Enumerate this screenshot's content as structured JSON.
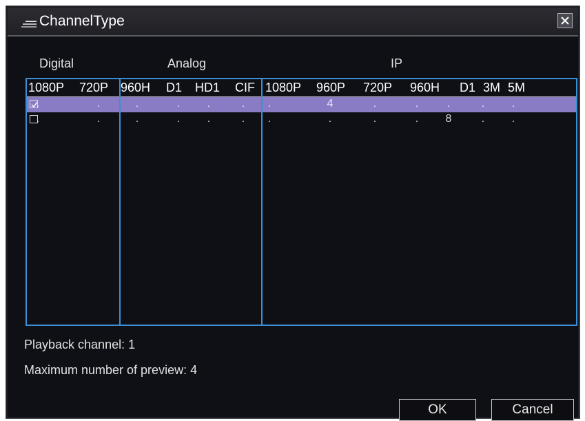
{
  "window": {
    "title": "ChannelType",
    "close_glyph": "✕"
  },
  "groups": {
    "digital": "Digital",
    "analog": "Analog",
    "ip": "IP"
  },
  "columns": [
    "1080P",
    "720P",
    "960H",
    "D1",
    "HD1",
    "CIF",
    "1080P",
    "960P",
    "720P",
    "960H",
    "D1",
    "3M",
    "5M"
  ],
  "rows": [
    {
      "checked": true,
      "selected": true,
      "cells": [
        ".",
        ".",
        ".",
        ".",
        ".",
        ".",
        ".",
        "4",
        ".",
        ".",
        ".",
        ".",
        "."
      ]
    },
    {
      "checked": false,
      "selected": false,
      "cells": [
        ".",
        ".",
        ".",
        ".",
        ".",
        ".",
        ".",
        ".",
        ".",
        ".",
        "8",
        ".",
        "."
      ]
    }
  ],
  "info": {
    "playback": "Playback channel: 1",
    "max_preview": "Maximum number of preview: 4"
  },
  "buttons": {
    "ok": "OK",
    "cancel": "Cancel"
  },
  "colors": {
    "border": "#3a8ed6",
    "selected_row": "#8a7cc4",
    "background": "#0f1016"
  },
  "icons": [
    "channel-icon",
    "close-icon",
    "checkbox-checked-icon",
    "checkbox-empty-icon"
  ]
}
